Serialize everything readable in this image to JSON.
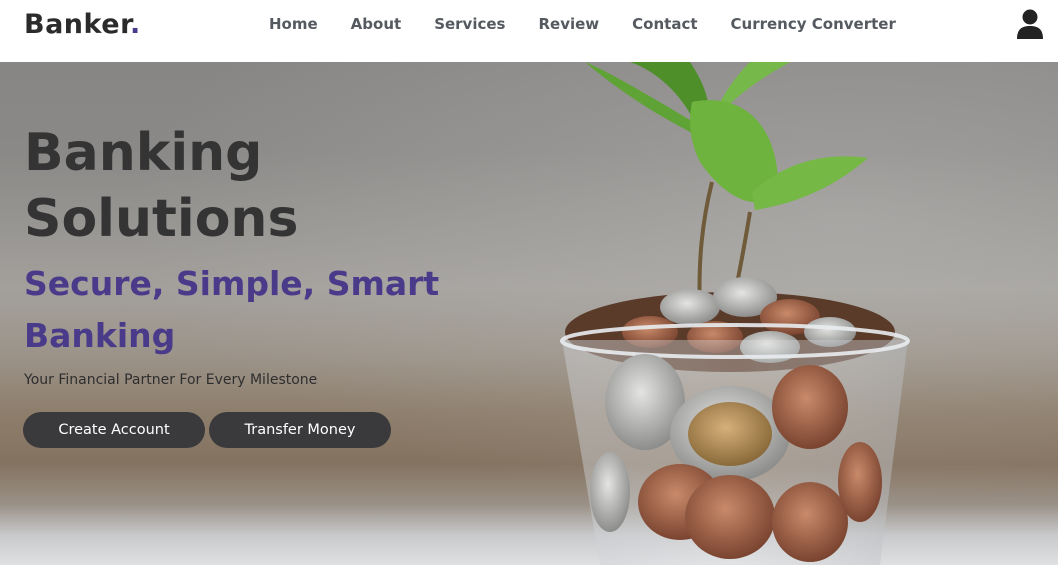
{
  "brand": {
    "name": "Banker",
    "dot": "."
  },
  "nav": {
    "links": [
      "Home",
      "About",
      "Services",
      "Review",
      "Contact",
      "Currency Converter"
    ],
    "user_icon": "user-icon"
  },
  "hero": {
    "title": "Banking Solutions",
    "subtitle": "Secure, Simple, Smart Banking",
    "tagline": "Your Financial Partner For Every Milestone",
    "buttons": {
      "create": "Create Account",
      "transfer": "Transfer Money"
    },
    "image": "plant-growing-from-glass-of-coins"
  },
  "colors": {
    "accent": "#4a3a8c",
    "button_bg": "#3a3a3c",
    "text_dark": "#343434"
  }
}
